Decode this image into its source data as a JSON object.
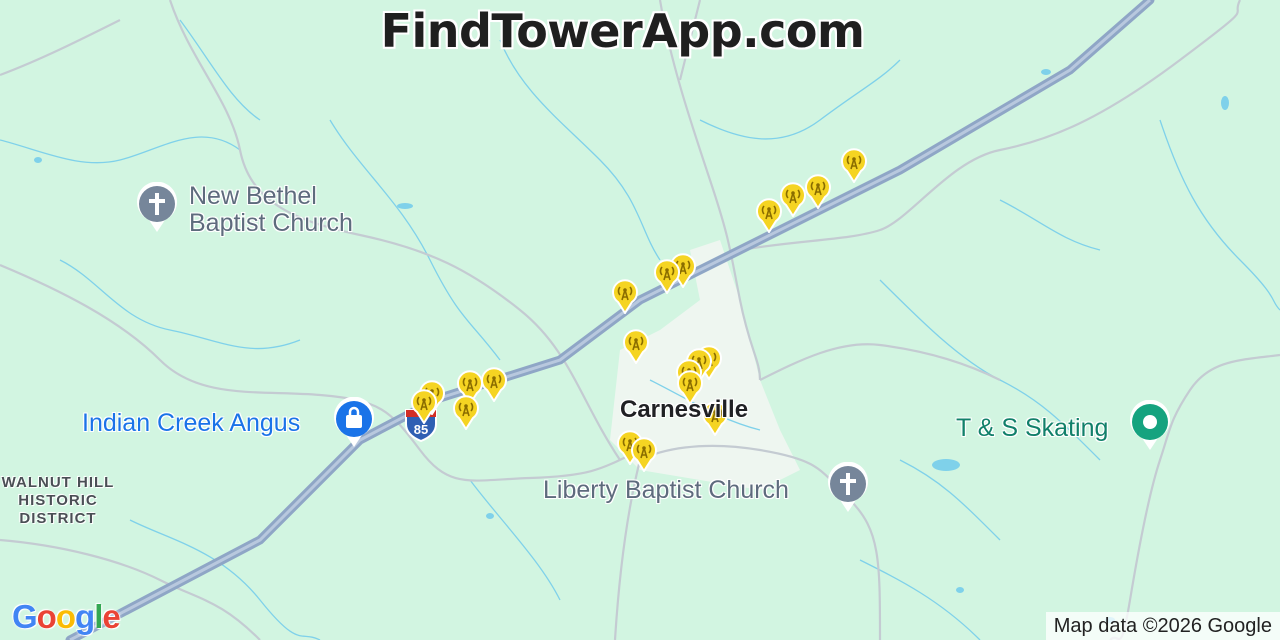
{
  "site": {
    "title": "FindTowerApp.com"
  },
  "places": {
    "church_1": "New Bethel\nBaptist Church",
    "church_2": "Liberty Baptist Church",
    "shop": "Indian Creek Angus",
    "rink": "T & S Skating",
    "town": "Carnesville",
    "district": "WALNUT HILL\nHISTORIC\nDISTRICT"
  },
  "highway": {
    "shield_number": "85"
  },
  "icons": {
    "church": "church-cross-icon",
    "shop": "shopping-bag-icon",
    "rink": "place-dot-icon",
    "tower": "cell-tower-icon"
  },
  "colors": {
    "map_bg": "#d2f5e1",
    "highway": "#8fa6c6",
    "road": "#c4cbd2",
    "tower_marker": "#f5d422",
    "church_pin": "#76869a",
    "shop_pin": "#1a73e8",
    "rink_pin": "#15a37f"
  },
  "tower_count": 20,
  "google": {
    "logo_text": "Google"
  },
  "attribution": "Map data ©2026 Google"
}
